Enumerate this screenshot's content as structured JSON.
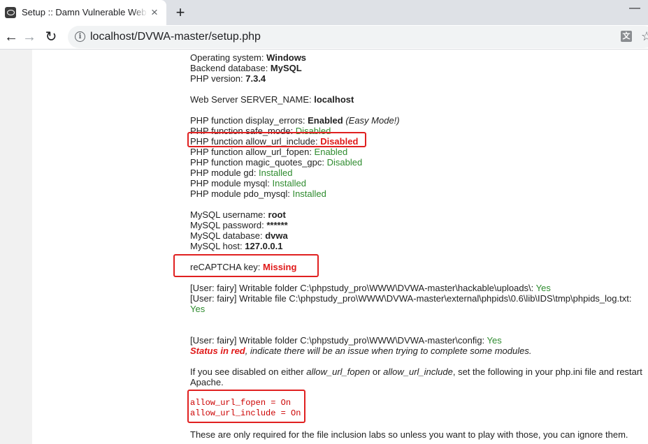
{
  "browser": {
    "tab_title": "Setup :: Damn Vulnerable Web",
    "tab_close": "×",
    "new_tab": "+",
    "minimize": "—",
    "back": "←",
    "forward": "→",
    "reload": "↻",
    "url": "localhost/DVWA-master/setup.php",
    "info": "i",
    "translate": "文",
    "star": "☆"
  },
  "system": {
    "os_label": "Operating system: ",
    "os_value": "Windows",
    "db_label": "Backend database: ",
    "db_value": "MySQL",
    "php_label": "PHP version: ",
    "php_value": "7.3.4",
    "server_label": "Web Server SERVER_NAME: ",
    "server_value": "localhost"
  },
  "php_checks": [
    {
      "label": "PHP function display_errors: ",
      "value": "Enabled",
      "note": " (Easy Mode!)"
    },
    {
      "label": "PHP function safe_mode: ",
      "value": "Disabled"
    },
    {
      "label": "PHP function allow_url_include: ",
      "value": "Disabled"
    },
    {
      "label": "PHP function allow_url_fopen: ",
      "value": "Enabled"
    },
    {
      "label": "PHP function magic_quotes_gpc: ",
      "value": "Disabled"
    },
    {
      "label": "PHP module gd: ",
      "value": "Installed"
    },
    {
      "label": "PHP module mysql: ",
      "value": "Installed"
    },
    {
      "label": "PHP module pdo_mysql: ",
      "value": "Installed"
    }
  ],
  "mysql": {
    "user_label": "MySQL username: ",
    "user_value": "root",
    "pass_label": "MySQL password: ",
    "pass_value": "******",
    "db_label": "MySQL database: ",
    "db_value": "dvwa",
    "host_label": "MySQL host: ",
    "host_value": "127.0.0.1"
  },
  "recaptcha": {
    "label": "reCAPTCHA key: ",
    "value": "Missing"
  },
  "folders": {
    "uploads_text": "[User: fairy] Writable folder C:\\phpstudy_pro\\WWW\\DVWA-master\\hackable\\uploads\\: ",
    "uploads_status": "Yes",
    "ids_text": "[User: fairy] Writable file C:\\phpstudy_pro\\WWW\\DVWA-master\\external\\phpids\\0.6\\lib\\IDS\\tmp\\phpids_log.txt:",
    "ids_status": "Yes",
    "config_text": "[User: fairy] Writable folder C:\\phpstudy_pro\\WWW\\DVWA-master\\config: ",
    "config_status": "Yes"
  },
  "status_note": {
    "red": "Status in red",
    "rest": ", indicate there will be an issue when trying to complete some modules."
  },
  "instructions": {
    "p1": "If you see disabled on either ",
    "fopen": "allow_url_fopen",
    "or": " or ",
    "include": "allow_url_include",
    "p2": ", set the following in your php.ini file and restart Apache.",
    "code1": "allow_url_fopen = On",
    "code2": "allow_url_include = On",
    "footer": "These are only required for the file inclusion labs so unless you want to play with those, you can ignore them."
  }
}
